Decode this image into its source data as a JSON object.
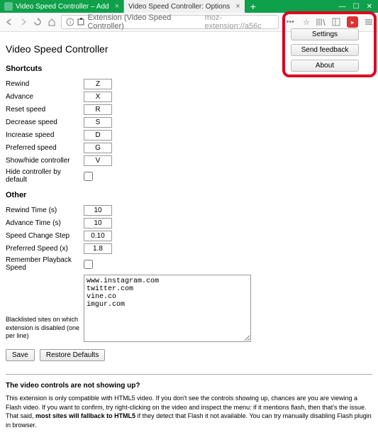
{
  "titlebar": {
    "tab1": "Video Speed Controller – Add",
    "tab2": "Video Speed Controller: Options"
  },
  "toolbar": {
    "address_prefix": "Extension (Video Speed Controller)",
    "address_url": "moz-extension://a56c"
  },
  "popup": {
    "settings": "Settings",
    "feedback": "Send feedback",
    "about": "About"
  },
  "page": {
    "title": "Video Speed Controller",
    "section_shortcuts": "Shortcuts",
    "rewind_label": "Rewind",
    "rewind_val": "Z",
    "advance_label": "Advance",
    "advance_val": "X",
    "reset_label": "Reset speed",
    "reset_val": "R",
    "dec_label": "Decrease speed",
    "dec_val": "S",
    "inc_label": "Increase speed",
    "inc_val": "D",
    "pref_label": "Preferred speed",
    "pref_val": "G",
    "show_label": "Show/hide controller",
    "show_val": "V",
    "hide_label": "Hide controller by default",
    "section_other": "Other",
    "rewind_time_label": "Rewind Time (s)",
    "rewind_time_val": "10",
    "advance_time_label": "Advance Time (s)",
    "advance_time_val": "10",
    "step_label": "Speed Change Step",
    "step_val": "0.10",
    "prefspeed_label": "Preferred Speed (x)",
    "prefspeed_val": "1.8",
    "remember_label": "Remember Playback Speed",
    "blacklist_label": "Blacklisted sites on which extension is disabled (one per line)",
    "blacklist_val": "www.instagram.com\ntwitter.com\nvine.co\nimgur.com",
    "save": "Save",
    "restore": "Restore Defaults",
    "help_title": "The video controls are not showing up?",
    "help_text_1": "This extension is only compatible with HTML5 video. If you don't see the controls showing up, chances are you are viewing a Flash video. If you want to confirm, try right-clicking on the video and inspect the menu: if it mentions flash, then that's the issue. That said, ",
    "help_text_bold": "most sites will fallback to HTML5",
    "help_text_2": " if they detect that Flash it not available. You can try manually disabling Flash plugin in browser."
  }
}
